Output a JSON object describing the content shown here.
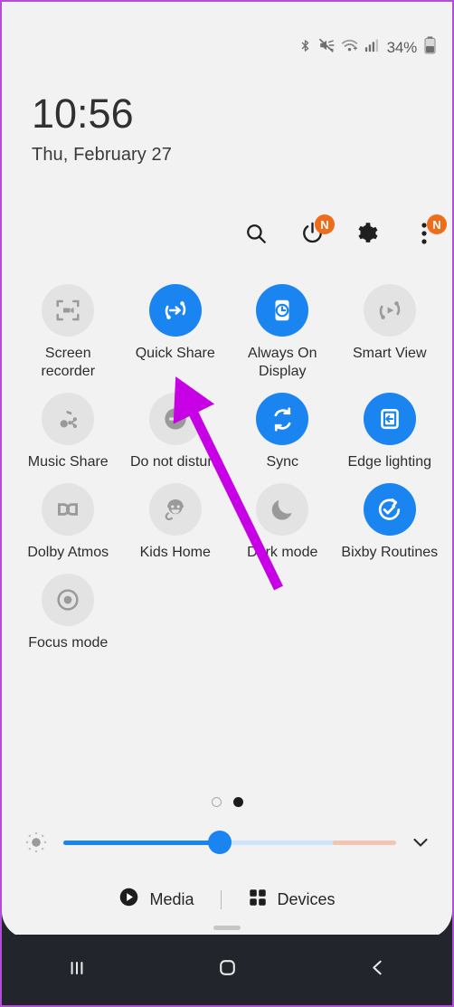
{
  "status_bar": {
    "icons": [
      "bluetooth-icon",
      "mute-icon",
      "wifi-icon",
      "signal-icon"
    ],
    "battery_percent": "34%"
  },
  "clock": {
    "time": "10:56",
    "date": "Thu, February 27"
  },
  "toolbar": {
    "buttons": [
      {
        "name": "search-icon",
        "label": "Search",
        "badge": ""
      },
      {
        "name": "power-icon",
        "label": "Power",
        "badge": "N"
      },
      {
        "name": "gear-icon",
        "label": "Settings",
        "badge": ""
      },
      {
        "name": "more-options-icon",
        "label": "More options",
        "badge": "N"
      }
    ]
  },
  "tiles": [
    {
      "label": "Screen recorder",
      "state": "off",
      "icon": "screen-recorder-icon"
    },
    {
      "label": "Quick Share",
      "state": "on",
      "icon": "quick-share-icon"
    },
    {
      "label": "Always On Display",
      "state": "on",
      "icon": "always-on-display-icon"
    },
    {
      "label": "Smart View",
      "state": "off",
      "icon": "smart-view-icon"
    },
    {
      "label": "Music Share",
      "state": "off",
      "icon": "music-share-icon"
    },
    {
      "label": "Do not disturb",
      "state": "off",
      "icon": "do-not-disturb-icon"
    },
    {
      "label": "Sync",
      "state": "on",
      "icon": "sync-icon"
    },
    {
      "label": "Edge lighting",
      "state": "on",
      "icon": "edge-lighting-icon"
    },
    {
      "label": "Dolby Atmos",
      "state": "off",
      "icon": "dolby-atmos-icon"
    },
    {
      "label": "Kids Home",
      "state": "off",
      "icon": "kids-home-icon"
    },
    {
      "label": "Dark mode",
      "state": "off",
      "icon": "dark-mode-icon"
    },
    {
      "label": "Bixby Routines",
      "state": "on",
      "icon": "bixby-routines-icon"
    },
    {
      "label": "Focus mode",
      "state": "off",
      "icon": "focus-mode-icon"
    }
  ],
  "page_indicator": {
    "total": 2,
    "active": 2
  },
  "brightness": {
    "value_percent": 47,
    "icon": "brightness-icon",
    "expand_icon": "chevron-down-icon"
  },
  "media_devices": {
    "media_label": "Media",
    "devices_label": "Devices"
  },
  "navigation_bar": {
    "recents_label": "Recents",
    "home_label": "Home",
    "back_label": "Back"
  },
  "annotation": {
    "color": "#c800e6",
    "points_from": "Dark mode",
    "points_to": "Quick Share"
  },
  "colors": {
    "tile_on": "#1a84f0",
    "tile_off": "#e3e3e3",
    "badge": "#ef6c1a",
    "panel_bg": "#f2f2f2",
    "navbar_bg": "#22252b",
    "border": "#b14fd8"
  }
}
